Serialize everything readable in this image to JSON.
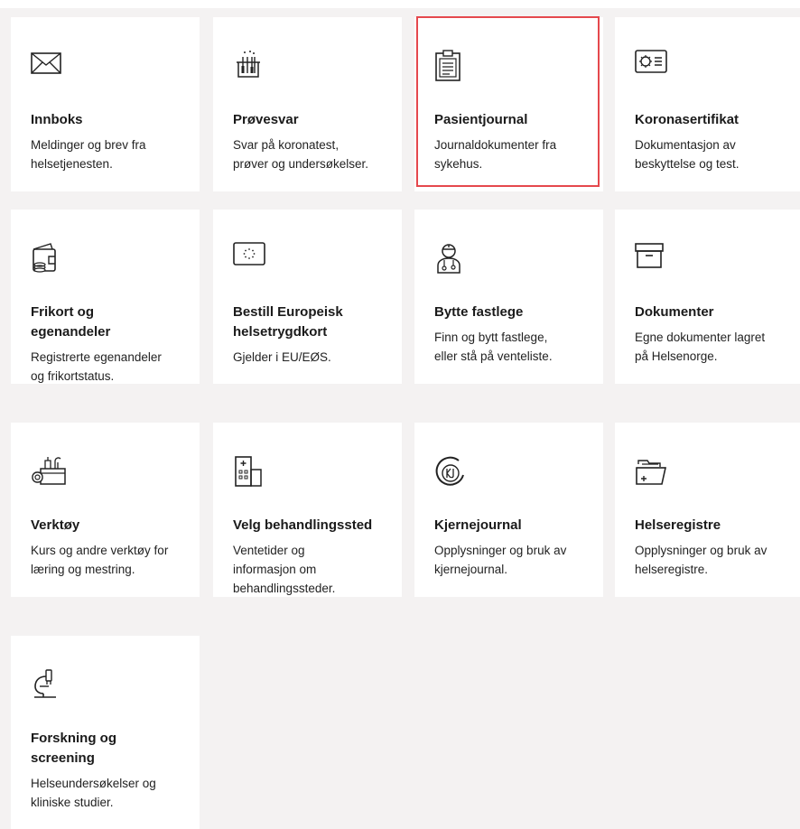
{
  "tiles": [
    {
      "title": "Innboks",
      "desc": "Meldinger og brev fra helsetjenesten.",
      "icon": "envelope-icon"
    },
    {
      "title": "Prøvesvar",
      "desc": "Svar på koronatest, prøver og undersøkelser.",
      "icon": "test-tubes-icon"
    },
    {
      "title": "Pasientjournal",
      "desc": "Journaldokumenter fra sykehus.",
      "icon": "clipboard-icon",
      "highlighted": true
    },
    {
      "title": "Koronasertifikat",
      "desc": "Dokumentasjon av beskyttelse og test.",
      "icon": "certificate-icon"
    },
    {
      "title": "Frikort og egenandeler",
      "desc": "Registrerte egenandeler og frikortstatus.",
      "icon": "wallet-icon"
    },
    {
      "title": "Bestill Europeisk helsetrygdkort",
      "desc": "Gjelder i EU/EØS.",
      "icon": "eu-card-icon"
    },
    {
      "title": "Bytte fastlege",
      "desc": "Finn og bytt fastlege, eller stå på venteliste.",
      "icon": "doctor-icon"
    },
    {
      "title": "Dokumenter",
      "desc": "Egne dokumenter lagret på Helsenorge.",
      "icon": "archive-box-icon"
    },
    {
      "title": "Verktøy",
      "desc": "Kurs og andre verktøy for læring og mestring.",
      "icon": "toolbox-icon"
    },
    {
      "title": "Velg behandlingssted",
      "desc": "Ventetider og informasjon om behandlingssteder.",
      "icon": "hospital-icon"
    },
    {
      "title": "Kjernejournal",
      "desc": "Opplysninger og bruk av kjernejournal.",
      "icon": "kj-logo-icon"
    },
    {
      "title": "Helseregistre",
      "desc": "Opplysninger og bruk av helseregistre.",
      "icon": "folder-plus-icon"
    },
    {
      "title": "Forskning og screening",
      "desc": "Helseundersøkelser og kliniske studier.",
      "icon": "microscope-icon"
    }
  ],
  "lines": {
    "t0": [
      "Innboks"
    ],
    "d0": [
      "Meldinger og brev fra",
      "helsetjenesten."
    ],
    "t1": [
      "Prøvesvar"
    ],
    "d1": [
      "Svar på koronatest,",
      "prøver og undersøkelser."
    ],
    "t2": [
      "Pasientjournal"
    ],
    "d2": [
      "Journaldokumenter fra",
      "sykehus."
    ],
    "t3": [
      "Koronasertifikat"
    ],
    "d3": [
      "Dokumentasjon av",
      "beskyttelse og test."
    ],
    "t4": [
      "Frikort og",
      "egenandeler"
    ],
    "d4": [
      "Registrerte egenandeler",
      "og frikortstatus."
    ],
    "t5": [
      "Bestill Europeisk",
      "helsetrygdkort"
    ],
    "d5": [
      "Gjelder i EU/EØS."
    ],
    "t6": [
      "Bytte fastlege"
    ],
    "d6": [
      "Finn og bytt fastlege,",
      "eller stå på venteliste."
    ],
    "t7": [
      "Dokumenter"
    ],
    "d7": [
      "Egne dokumenter lagret",
      "på Helsenorge."
    ],
    "t8": [
      "Verktøy"
    ],
    "d8": [
      "Kurs og andre verktøy for",
      "læring og mestring."
    ],
    "t9": [
      "Velg behandlingssted"
    ],
    "d9": [
      "Ventetider og",
      "informasjon om",
      "behandlingssteder."
    ],
    "t10": [
      "Kjernejournal"
    ],
    "d10": [
      "Opplysninger og bruk av",
      "kjernejournal."
    ],
    "t11": [
      "Helseregistre"
    ],
    "d11": [
      "Opplysninger og bruk av",
      "helseregistre."
    ],
    "t12": [
      "Forskning og",
      "screening"
    ],
    "d12": [
      "Helseundersøkelser og",
      "kliniske studier."
    ]
  },
  "colors": {
    "tile": "#ffffff",
    "background": "#f4f2f2",
    "highlight": "#e5484d"
  }
}
